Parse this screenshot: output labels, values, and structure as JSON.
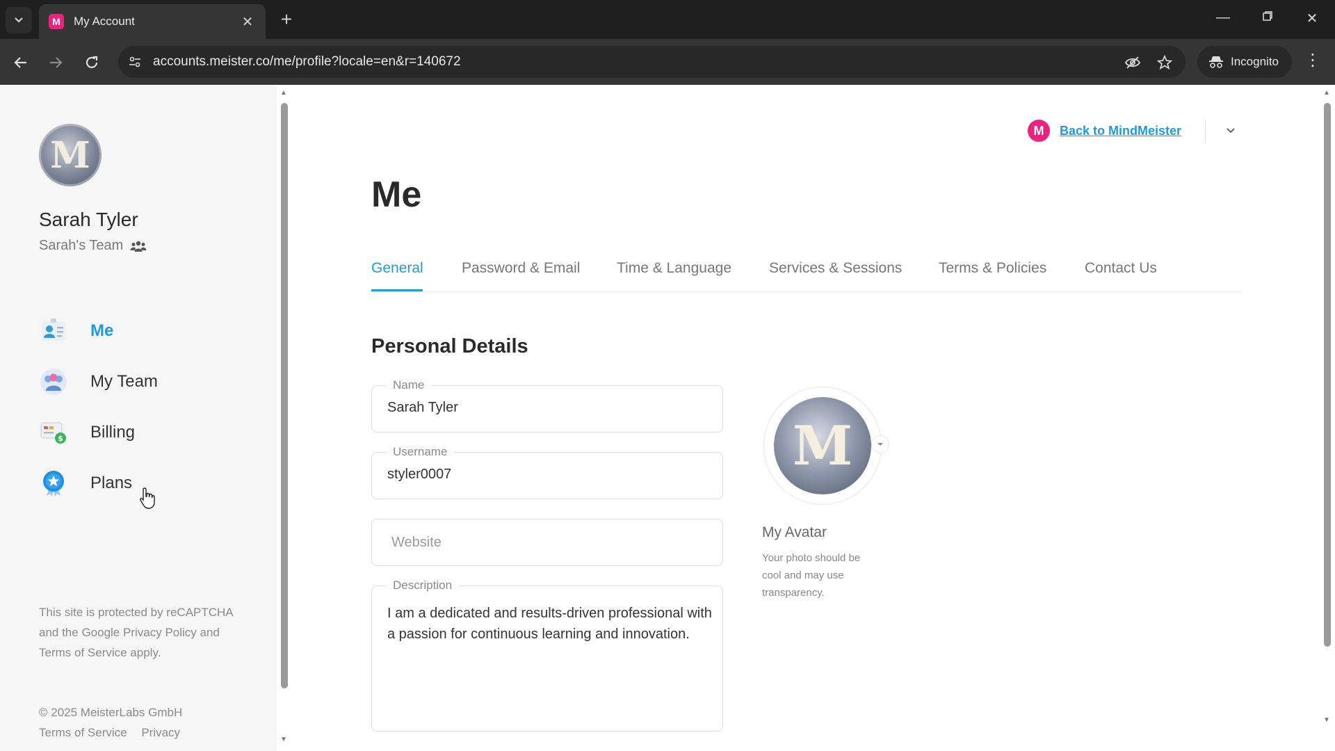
{
  "browser": {
    "tab_title": "My Account",
    "tab_favicon": "M",
    "url": "accounts.meister.co/me/profile?locale=en&r=140672",
    "incognito_label": "Incognito"
  },
  "sidebar": {
    "user_name": "Sarah Tyler",
    "team_name": "Sarah's Team",
    "avatar_letter": "M",
    "nav": [
      {
        "label": "Me",
        "icon": "me-icon"
      },
      {
        "label": "My Team",
        "icon": "team-icon"
      },
      {
        "label": "Billing",
        "icon": "billing-icon"
      },
      {
        "label": "Plans",
        "icon": "plans-icon"
      }
    ],
    "recaptcha": "This site is protected by reCAPTCHA and the Google Privacy Policy and Terms of Service apply.",
    "copyright": "© 2025 MeisterLabs GmbH",
    "footer_link_tos": "Terms of Service",
    "footer_link_privacy": "Privacy"
  },
  "header": {
    "back_link": "Back to MindMeister",
    "logo_letter": "M"
  },
  "main": {
    "page_title": "Me",
    "tabs": [
      "General",
      "Password & Email",
      "Time & Language",
      "Services & Sessions",
      "Terms & Policies",
      "Contact Us"
    ],
    "section_title": "Personal Details",
    "fields": {
      "name_label": "Name",
      "name_value": "Sarah Tyler",
      "username_label": "Username",
      "username_value": "styler0007",
      "website_placeholder": "Website",
      "description_label": "Description",
      "description_value": "I am a dedicated and results-driven professional with a passion for continuous learning and innovation."
    },
    "avatar": {
      "title": "My Avatar",
      "hint": "Your photo should be cool and may use transparency.",
      "letter": "M"
    }
  },
  "colors": {
    "accent": "#1f9bd8",
    "brand": "#e8247e"
  }
}
